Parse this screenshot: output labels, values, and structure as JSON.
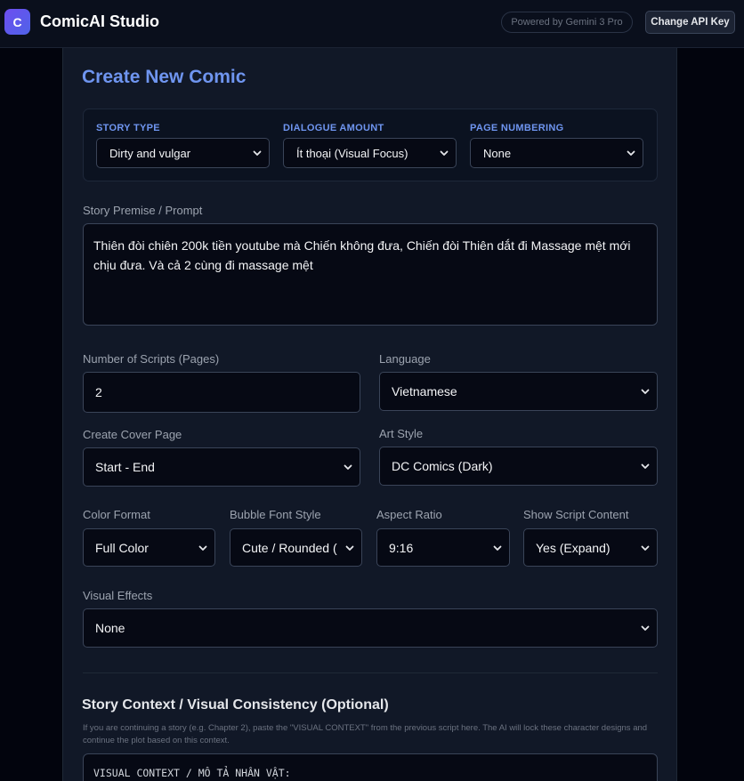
{
  "header": {
    "logo_letter": "C",
    "app_title": "ComicAI Studio",
    "powered_by": "Powered by Gemini 3 Pro",
    "api_key_button": "Change API Key"
  },
  "form": {
    "title": "Create New Comic",
    "story_type": {
      "label": "STORY TYPE",
      "value": "Dirty and vulgar"
    },
    "dialogue_amount": {
      "label": "DIALOGUE AMOUNT",
      "value": "Ít thoại (Visual Focus)"
    },
    "page_numbering": {
      "label": "PAGE NUMBERING",
      "value": "None"
    },
    "premise": {
      "label": "Story Premise / Prompt",
      "value": "Thiên đòi chiên 200k tiền youtube mà Chiến không đưa, Chiến đòi Thiên dắt đi Massage mệt mới chịu đưa. Và cả 2 cùng đi massage mệt"
    },
    "num_scripts": {
      "label": "Number of Scripts (Pages)",
      "value": "2"
    },
    "language": {
      "label": "Language",
      "value": "Vietnamese"
    },
    "cover_page": {
      "label": "Create Cover Page",
      "value": "Start - End"
    },
    "art_style": {
      "label": "Art Style",
      "value": "DC Comics (Dark)"
    },
    "color_format": {
      "label": "Color Format",
      "value": "Full Color"
    },
    "bubble_font": {
      "label": "Bubble Font Style",
      "value": "Cute / Rounded ("
    },
    "aspect_ratio": {
      "label": "Aspect Ratio",
      "value": "9:16"
    },
    "show_script": {
      "label": "Show Script Content",
      "value": "Yes (Expand)"
    },
    "visual_effects": {
      "label": "Visual Effects",
      "value": "None"
    }
  },
  "context": {
    "title": "Story Context / Visual Consistency (Optional)",
    "help": "If you are continuing a story (e.g. Chapter 2), paste the \"VISUAL CONTEXT\" from the previous script here. The AI will lock these character designs and continue the plot based on this context.",
    "value": "VISUAL CONTEXT / MÔ TẢ NHÂN VẬT:"
  },
  "colors": {
    "accent": "#6f95f0",
    "background": "#02040d",
    "panel": "#111827",
    "logo_gradient": [
      "#6d4ef0",
      "#4f63e8"
    ]
  },
  "icons": {
    "select_arrow": "chevron-down-icon"
  }
}
